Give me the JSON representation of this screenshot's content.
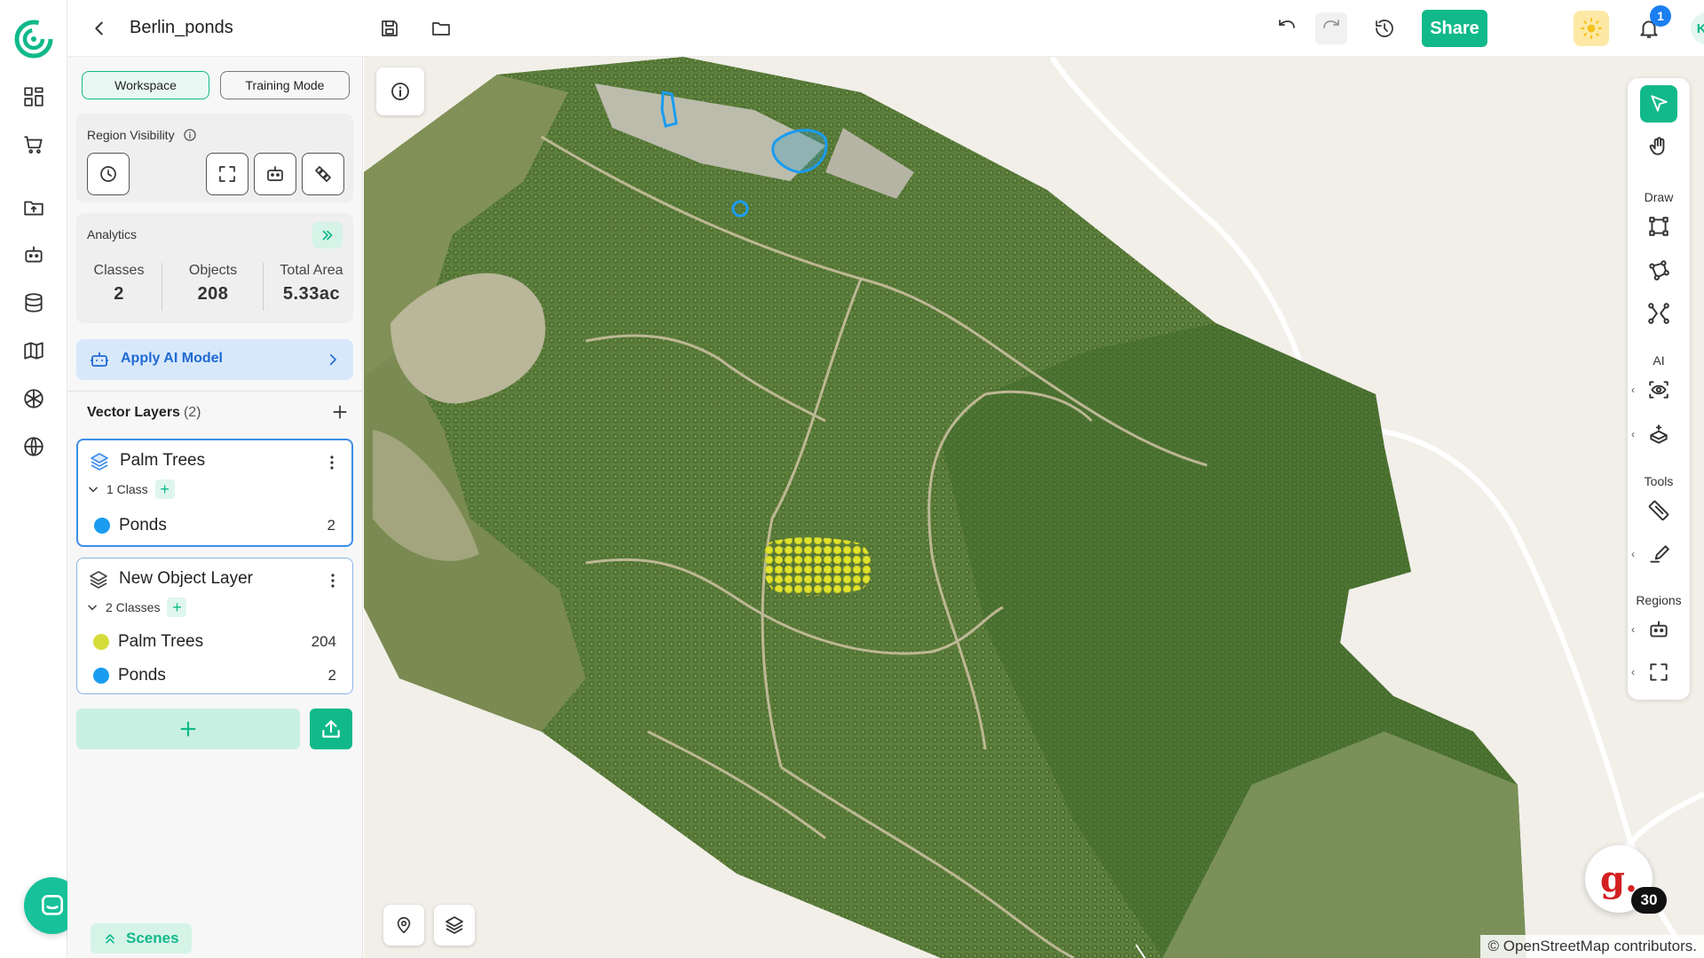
{
  "header": {
    "title": "Berlin_ponds",
    "share_label": "Share",
    "notification_count": "1",
    "user_initials": "KG"
  },
  "panel": {
    "modes": [
      {
        "label": "Workspace",
        "active": true
      },
      {
        "label": "Training Mode",
        "active": false
      }
    ],
    "region_visibility_title": "Region Visibility",
    "analytics": {
      "title": "Analytics",
      "stats": [
        {
          "label": "Classes",
          "value": "2"
        },
        {
          "label": "Objects",
          "value": "208"
        },
        {
          "label": "Total Area",
          "value": "5.33ac"
        }
      ]
    },
    "apply_ai_label": "Apply AI Model",
    "vector_layers": {
      "title": "Vector Layers",
      "count": "(2)",
      "layers": [
        {
          "name": "Palm Trees",
          "classes_label": "1 Class",
          "items": [
            {
              "name": "Ponds",
              "count": "2",
              "color": "#1a9cf0"
            }
          ]
        },
        {
          "name": "New Object Layer",
          "classes_label": "2 Classes",
          "items": [
            {
              "name": "Palm Trees",
              "count": "204",
              "color": "#d4dc3a"
            },
            {
              "name": "Ponds",
              "count": "2",
              "color": "#1a9cf0"
            }
          ]
        }
      ]
    },
    "scenes_label": "Scenes"
  },
  "right_toolbar": {
    "sections": [
      "Draw",
      "AI",
      "Tools",
      "Regions"
    ]
  },
  "map": {
    "attribution": "© OpenStreetMap contributors.",
    "g_badge": "30",
    "g_letter": "g."
  },
  "colors": {
    "accent": "#11b98a",
    "pond": "#1a9cf0",
    "palm": "#d4dc3a"
  }
}
